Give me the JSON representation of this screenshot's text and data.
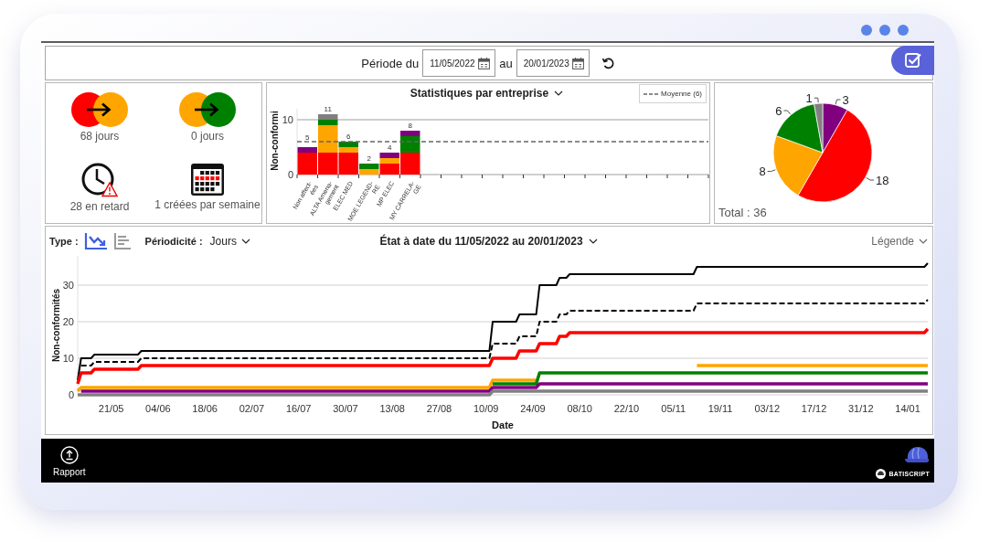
{
  "toolbar": {
    "period_label": "Période du",
    "start_date": "11/05/2022",
    "to_label": "au",
    "end_date": "20/01/2023"
  },
  "kpis": [
    {
      "kind": "transition",
      "circles": [
        {
          "color": "#ff0000"
        },
        {
          "color": "#ffa500"
        }
      ],
      "label": "68 jours"
    },
    {
      "kind": "transition",
      "circles": [
        {
          "color": "#ffa500"
        },
        {
          "color": "#008000"
        }
      ],
      "label": "0 jours"
    },
    {
      "kind": "clock",
      "label": "28 en retard"
    },
    {
      "kind": "calendar",
      "label": "1 créées par semaine"
    }
  ],
  "company_stats": {
    "chart_data": {
      "type": "bar",
      "title": "Statistiques par entreprise",
      "ylabel": "Non-conformi",
      "categories": [
        "Non affect-ées",
        "ALTA Amena-gement",
        "ELEC MED",
        "MOE LEGEND-RE",
        "MP ELEC",
        "MY CARRELA-GE"
      ],
      "series": [
        {
          "color": "#ff0000",
          "values": [
            4,
            4,
            4,
            0,
            2,
            4
          ]
        },
        {
          "color": "#ffa500",
          "values": [
            0,
            5,
            1,
            1,
            1,
            0
          ]
        },
        {
          "color": "#008000",
          "values": [
            0,
            1,
            1,
            1,
            0,
            3
          ]
        },
        {
          "color": "#800080",
          "values": [
            1,
            0,
            0,
            0,
            1,
            1
          ]
        },
        {
          "color": "#808080",
          "values": [
            0,
            1,
            0,
            0,
            0,
            0
          ]
        }
      ],
      "stacked": true,
      "ylim": [
        0,
        12
      ],
      "yticks": [
        0,
        10
      ],
      "grid": true,
      "value_labels": [
        [
          null,
          null,
          null,
          null,
          null,
          null
        ],
        [
          null,
          null,
          null,
          null,
          null,
          null
        ],
        [
          null,
          null,
          "6",
          "2",
          null,
          null
        ],
        [
          "5",
          null,
          null,
          null,
          "4",
          "8"
        ],
        [
          null,
          "11",
          null,
          null,
          null,
          null
        ]
      ],
      "ref_lines": [
        {
          "axis": "y",
          "value": 6,
          "label": "Moyenne (6)"
        }
      ]
    }
  },
  "distribution": {
    "chart_data": {
      "type": "pie",
      "series": [
        {
          "values": [
            3,
            18,
            8,
            6,
            1
          ],
          "colors": [
            "#800080",
            "#ff0000",
            "#ffa500",
            "#008000",
            "#808080"
          ]
        }
      ],
      "data_labels": true
    },
    "total": "Total : 36"
  },
  "timeline": {
    "type_label": "Type :",
    "view_modes": [
      {
        "kind": "line",
        "selected": true
      },
      {
        "kind": "list",
        "selected": false
      }
    ],
    "period_label": "Périodicité :",
    "period_value": "Jours",
    "legend_label": "Légende",
    "chart_data": {
      "type": "line",
      "title": "État à date du 11/05/2022 au 20/01/2023",
      "xlabel": "Date",
      "ylabel": "Non-conformités",
      "grid": true,
      "x": [
        "2022-05-11",
        "2022-05-12",
        "2022-05-15",
        "2022-05-16",
        "2022-05-29",
        "2022-05-30",
        "2022-09-11",
        "2022-09-12",
        "2022-09-19",
        "2022-09-20",
        "2022-09-25",
        "2022-09-26",
        "2022-10-01",
        "2022-10-02",
        "2022-10-04",
        "2022-10-05",
        "2022-11-11",
        "2022-11-12",
        "2023-01-19",
        "2023-01-20"
      ],
      "series": [
        {
          "color": "#000000",
          "line_style": "solid",
          "values": [
            4,
            10,
            10,
            11,
            11,
            12,
            12,
            20,
            20,
            22,
            22,
            30,
            30,
            32,
            32,
            33,
            33,
            35,
            35,
            36
          ]
        },
        {
          "color": "#000000",
          "line_style": "dashed",
          "values": [
            null,
            8,
            8,
            9,
            9,
            10,
            10,
            14,
            14,
            16,
            16,
            20,
            20,
            22,
            22,
            23,
            23,
            25,
            25,
            26
          ]
        },
        {
          "color": "#ff0000",
          "line_style": "solid",
          "values": [
            3,
            6,
            6,
            7,
            7,
            8,
            8,
            10,
            10,
            12,
            12,
            14,
            14,
            16,
            16,
            17,
            17,
            17,
            17,
            18
          ]
        },
        {
          "color": "#ffa500",
          "line_style": "solid",
          "values": [
            1,
            2,
            2,
            2,
            2,
            2,
            2,
            4,
            4,
            4,
            4,
            null,
            null,
            null,
            null,
            null,
            null,
            8,
            8,
            8
          ]
        },
        {
          "color": "#008000",
          "line_style": "solid",
          "values": [
            null,
            null,
            null,
            null,
            null,
            null,
            null,
            3,
            3,
            3,
            3,
            6,
            6,
            6,
            6,
            6,
            6,
            6,
            6,
            6
          ]
        },
        {
          "color": "#800080",
          "line_style": "solid",
          "values": [
            null,
            1,
            1,
            1,
            1,
            1,
            1,
            2,
            2,
            2,
            2,
            3,
            3,
            3,
            3,
            3,
            3,
            3,
            3,
            3
          ]
        },
        {
          "color": "#808080",
          "line_style": "solid",
          "values": [
            0,
            0,
            0,
            0,
            0,
            0,
            0,
            1,
            1,
            1,
            1,
            1,
            1,
            1,
            1,
            1,
            1,
            1,
            1,
            1
          ]
        }
      ],
      "xlim": [
        "2022-05-11",
        "2023-01-20"
      ],
      "ylim": [
        0,
        38
      ],
      "xticks": [
        {
          "value": "2022-05-21",
          "label": "21/05"
        },
        {
          "value": "2022-06-04",
          "label": "04/06"
        },
        {
          "value": "2022-06-18",
          "label": "18/06"
        },
        {
          "value": "2022-07-02",
          "label": "02/07"
        },
        {
          "value": "2022-07-16",
          "label": "16/07"
        },
        {
          "value": "2022-07-30",
          "label": "30/07"
        },
        {
          "value": "2022-08-13",
          "label": "13/08"
        },
        {
          "value": "2022-08-27",
          "label": "27/08"
        },
        {
          "value": "2022-09-10",
          "label": "10/09"
        },
        {
          "value": "2022-09-24",
          "label": "24/09"
        },
        {
          "value": "2022-10-08",
          "label": "08/10"
        },
        {
          "value": "2022-10-22",
          "label": "22/10"
        },
        {
          "value": "2022-11-05",
          "label": "05/11"
        },
        {
          "value": "2022-11-19",
          "label": "19/11"
        },
        {
          "value": "2022-12-03",
          "label": "03/12"
        },
        {
          "value": "2022-12-17",
          "label": "17/12"
        },
        {
          "value": "2022-12-31",
          "label": "31/12"
        },
        {
          "value": "2023-01-14",
          "label": "14/01"
        }
      ],
      "yticks": [
        0,
        10,
        20,
        30
      ]
    }
  },
  "footer": {
    "report_label": "Rapport",
    "brand": "BATISCRIPT"
  }
}
